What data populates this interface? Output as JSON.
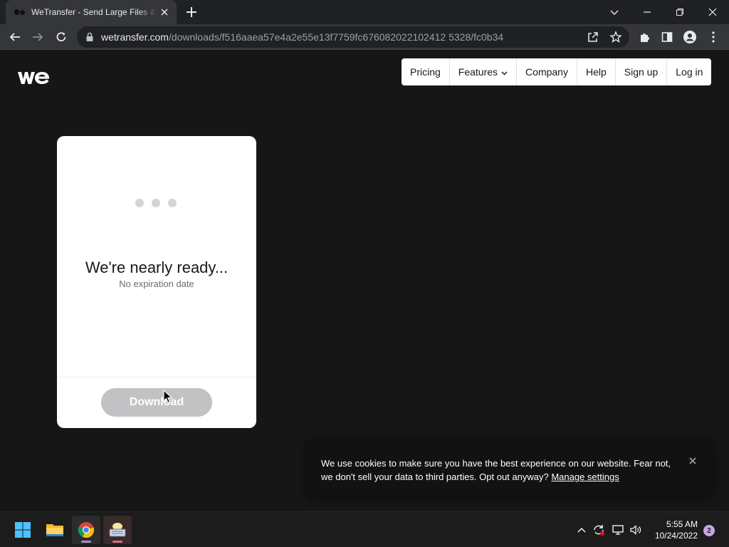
{
  "browser": {
    "tab_title": "WeTransfer - Send Large Files & Share Photos Online",
    "url_domain": "wetransfer.com",
    "url_path": "/downloads/f516aaea57e4a2e55e13f7759fc676082022102412 5328/fc0b34"
  },
  "site": {
    "logo_icon": "wetransfer-logo",
    "nav": {
      "pricing": "Pricing",
      "features": "Features",
      "company": "Company",
      "help": "Help",
      "signup": "Sign up",
      "login": "Log in"
    }
  },
  "card": {
    "title": "We're nearly ready...",
    "subtitle": "No expiration date",
    "download_label": "Download"
  },
  "cookie": {
    "text": "We use cookies to make sure you have the best experience on our website. Fear not, we don't sell your data to third parties. Opt out anyway?",
    "link": "Manage settings"
  },
  "taskbar": {
    "time": "5:55 AM",
    "date": "10/24/2022",
    "notification_count": "2"
  }
}
